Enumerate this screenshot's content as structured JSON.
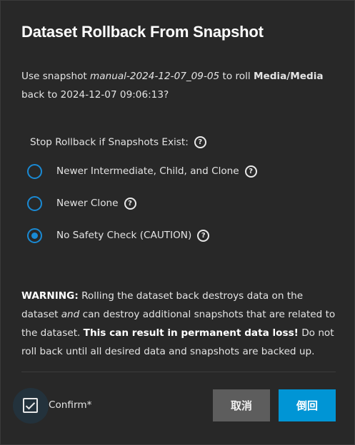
{
  "dialog": {
    "title": "Dataset Rollback From Snapshot",
    "intro": {
      "prefix": "Use snapshot ",
      "snapshot": "manual-2024-12-07_09-05",
      "middle": " to roll ",
      "dataset": "Media/Media",
      "line2": "back to 2024-12-07 09:06:13?"
    },
    "radio_group": {
      "label": "Stop Rollback if Snapshots Exist:",
      "options": [
        {
          "label": "Newer Intermediate, Child, and Clone",
          "checked": false
        },
        {
          "label": "Newer Clone",
          "checked": false
        },
        {
          "label": "No Safety Check (CAUTION)",
          "checked": true
        }
      ]
    },
    "warning": {
      "prefix": "WARNING:",
      "text1": " Rolling the dataset back destroys data on the dataset ",
      "and": "and",
      "text2": " can destroy additional snapshots that are related to the dataset. ",
      "emphasis": "This can result in permanent data loss!",
      "text3": " Do not roll back until all desired data and snapshots are backed up."
    },
    "confirm": {
      "label": "Confirm*",
      "checked": true
    },
    "buttons": {
      "cancel": "取消",
      "ok": "倒回"
    },
    "colors": {
      "accent": "#0095d5",
      "radio": "#1a8ad4",
      "cancel_bg": "#5d5d5d"
    },
    "icons": {
      "help": "help-circle-icon",
      "check": "check-icon"
    }
  }
}
